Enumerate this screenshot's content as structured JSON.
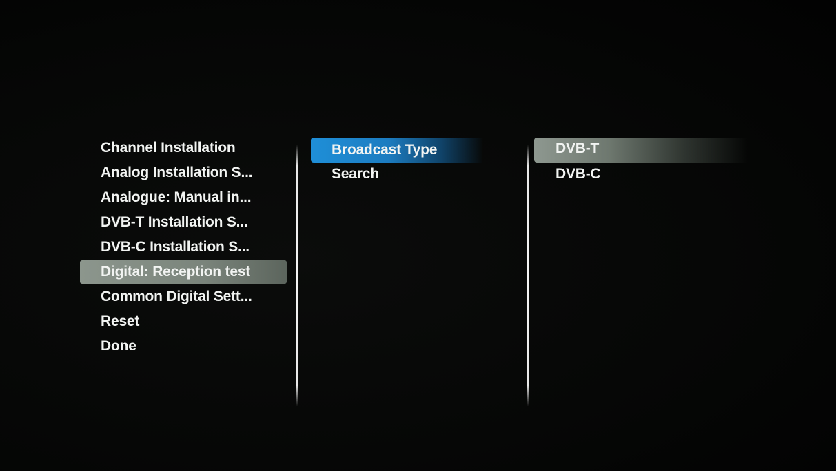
{
  "menu_level1": {
    "items": [
      {
        "label": "Channel Installation"
      },
      {
        "label": "Analog Installation S..."
      },
      {
        "label": "Analogue: Manual in..."
      },
      {
        "label": "DVB-T Installation S..."
      },
      {
        "label": "DVB-C Installation S..."
      },
      {
        "label": "Digital: Reception test",
        "selected": true
      },
      {
        "label": "Common Digital Sett..."
      },
      {
        "label": "Reset"
      },
      {
        "label": "Done"
      }
    ]
  },
  "menu_level2": {
    "items": [
      {
        "label": "Broadcast Type",
        "focused": true
      },
      {
        "label": "Search"
      }
    ]
  },
  "menu_level3": {
    "items": [
      {
        "label": "DVB-T",
        "selected": true
      },
      {
        "label": "DVB-C"
      }
    ]
  },
  "colors": {
    "focus_highlight": "#1f8fd8",
    "selection_highlight": "#8c968d",
    "background": "#000000",
    "text": "#f2f4f2"
  }
}
